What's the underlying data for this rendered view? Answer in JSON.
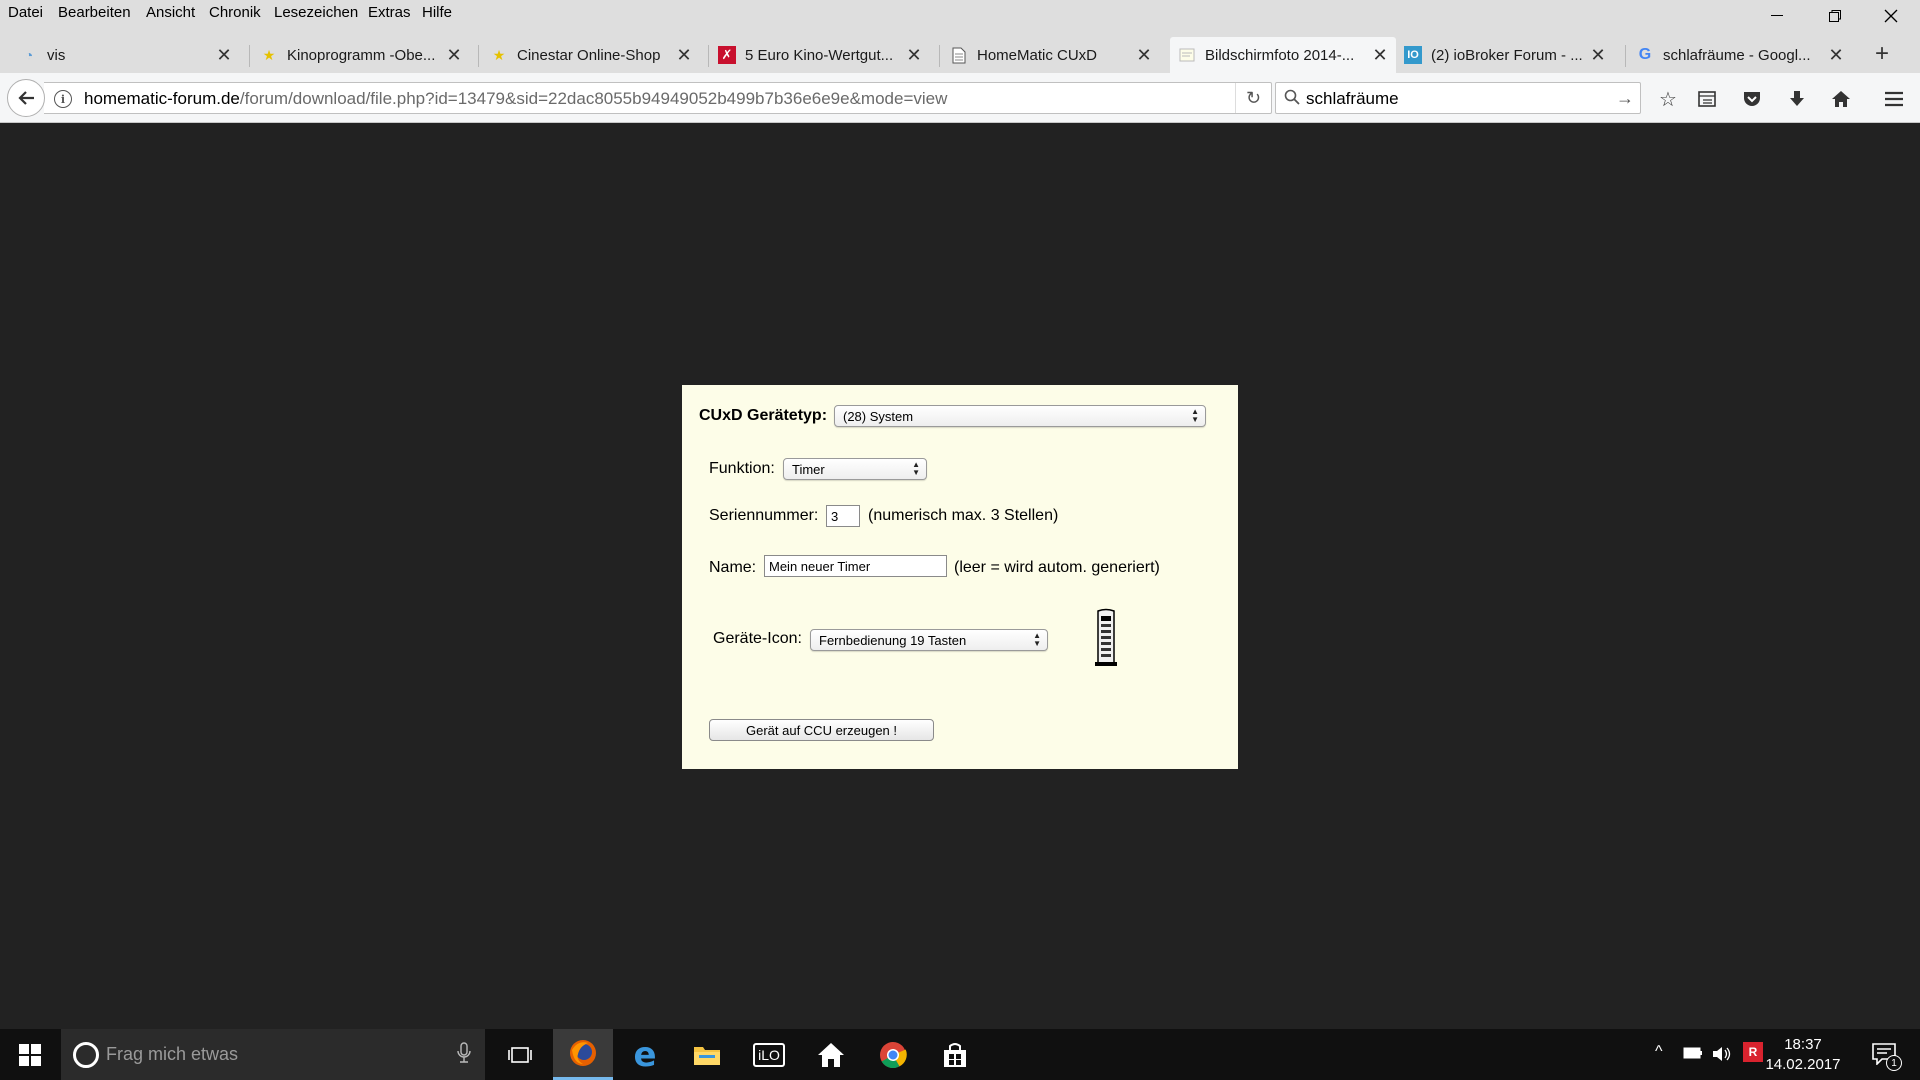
{
  "menu": [
    "Datei",
    "Bearbeiten",
    "Ansicht",
    "Chronik",
    "Lesezeichen",
    "Extras",
    "Hilfe"
  ],
  "tabs": [
    {
      "title": "vis",
      "icon": "gauge-icon"
    },
    {
      "title": "Kinoprogramm -Obe...",
      "icon": "star-icon"
    },
    {
      "title": "Cinestar Online-Shop",
      "icon": "star-icon"
    },
    {
      "title": "5 Euro Kino-Wertgut...",
      "icon": "red-x-icon"
    },
    {
      "title": "HomeMatic CUxD",
      "icon": "document-icon"
    },
    {
      "title": "Bildschirmfoto 2014-...",
      "icon": "image-icon"
    },
    {
      "title": "(2) ioBroker Forum - ...",
      "icon": "iobroker-icon"
    },
    {
      "title": "schlafräume - Googl...",
      "icon": "google-icon"
    }
  ],
  "url": {
    "host": "homematic-forum.de",
    "path": "/forum/download/file.php?id=13479&sid=22dac8055b94949052b499b7b36e6e9e&mode=view"
  },
  "search": {
    "value": "schlafräume"
  },
  "cuxd": {
    "type_label": "CUxD Gerätetyp:",
    "type_value": "(28) System",
    "function_label": "Funktion:",
    "function_value": "Timer",
    "serial_label": "Seriennummer:",
    "serial_value": "3",
    "serial_hint": "(numerisch max. 3 Stellen)",
    "name_label": "Name:",
    "name_value": "Mein neuer Timer",
    "name_hint": "(leer = wird autom. generiert)",
    "icon_label": "Geräte-Icon:",
    "icon_value": "Fernbedienung 19 Tasten",
    "create_button": "Gerät auf CCU erzeugen !"
  },
  "taskbar": {
    "search_placeholder": "Frag mich etwas",
    "time": "18:37",
    "date": "14.02.2017",
    "notification_count": "1"
  },
  "colors": {
    "content_bg": "#222222",
    "image_bg": "#fdfde8",
    "taskbar_bg": "#101010",
    "accent": "#76b9ed"
  }
}
